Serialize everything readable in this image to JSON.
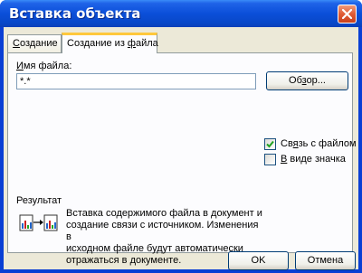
{
  "window": {
    "title": "Вставка объекта"
  },
  "tabs": {
    "create_underlined": "С",
    "create_rest": "оздание",
    "from_file_before": "Создание из ",
    "from_file_underlined": "ф",
    "from_file_after": "айла"
  },
  "form": {
    "file_label_underlined": "И",
    "file_label_rest": "мя файла:",
    "file_value": "*.*",
    "browse_before": "Об",
    "browse_underlined": "з",
    "browse_after": "ор..."
  },
  "options": {
    "link_before": "Св",
    "link_underlined": "я",
    "link_after": "зь с файлом",
    "link_checked": true,
    "icon_underlined": "В",
    "icon_rest": " виде значка",
    "icon_checked": false
  },
  "result": {
    "title": "Результат",
    "text": "Вставка содержимого файла в документ и\nсоздание связи с источником.  Изменения в\nисходном файле будут автоматически\nотражаться в документе."
  },
  "buttons": {
    "ok": "OK",
    "cancel": "Отмена"
  }
}
